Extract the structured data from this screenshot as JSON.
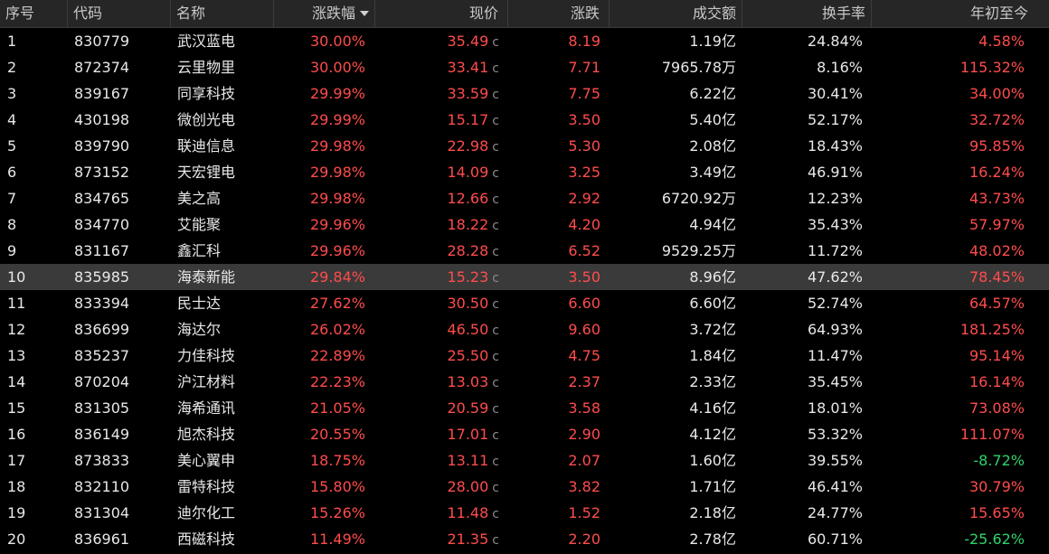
{
  "colors": {
    "up": "#ff4c4c",
    "down": "#2fd36a",
    "header_bg": "#262626",
    "row_selected_bg": "#3a3a3a",
    "background": "#000000"
  },
  "header": {
    "index": "序号",
    "code": "代码",
    "name": "名称",
    "change_pct": "涨跌幅",
    "price": "现价",
    "change": "涨跌",
    "turnover": "成交额",
    "turnover_rate": "换手率",
    "ytd": "年初至今"
  },
  "sort": {
    "column": "change_pct",
    "direction": "desc",
    "icon": "sort-desc-icon"
  },
  "selected_row": 10,
  "price_marker": "c",
  "rows": [
    {
      "index": "1",
      "code": "830779",
      "name": "武汉蓝电",
      "change_pct": "30.00%",
      "price": "35.49",
      "change": "8.19",
      "turnover": "1.19亿",
      "turnover_rate": "24.84%",
      "ytd": "4.58%",
      "ytd_dir": "up"
    },
    {
      "index": "2",
      "code": "872374",
      "name": "云里物里",
      "change_pct": "30.00%",
      "price": "33.41",
      "change": "7.71",
      "turnover": "7965.78万",
      "turnover_rate": "8.16%",
      "ytd": "115.32%",
      "ytd_dir": "up"
    },
    {
      "index": "3",
      "code": "839167",
      "name": "同享科技",
      "change_pct": "29.99%",
      "price": "33.59",
      "change": "7.75",
      "turnover": "6.22亿",
      "turnover_rate": "30.41%",
      "ytd": "34.00%",
      "ytd_dir": "up"
    },
    {
      "index": "4",
      "code": "430198",
      "name": "微创光电",
      "change_pct": "29.99%",
      "price": "15.17",
      "change": "3.50",
      "turnover": "5.40亿",
      "turnover_rate": "52.17%",
      "ytd": "32.72%",
      "ytd_dir": "up"
    },
    {
      "index": "5",
      "code": "839790",
      "name": "联迪信息",
      "change_pct": "29.98%",
      "price": "22.98",
      "change": "5.30",
      "turnover": "2.08亿",
      "turnover_rate": "18.43%",
      "ytd": "95.85%",
      "ytd_dir": "up"
    },
    {
      "index": "6",
      "code": "873152",
      "name": "天宏锂电",
      "change_pct": "29.98%",
      "price": "14.09",
      "change": "3.25",
      "turnover": "3.49亿",
      "turnover_rate": "46.91%",
      "ytd": "16.24%",
      "ytd_dir": "up"
    },
    {
      "index": "7",
      "code": "834765",
      "name": "美之高",
      "change_pct": "29.98%",
      "price": "12.66",
      "change": "2.92",
      "turnover": "6720.92万",
      "turnover_rate": "12.23%",
      "ytd": "43.73%",
      "ytd_dir": "up"
    },
    {
      "index": "8",
      "code": "834770",
      "name": "艾能聚",
      "change_pct": "29.96%",
      "price": "18.22",
      "change": "4.20",
      "turnover": "4.94亿",
      "turnover_rate": "35.43%",
      "ytd": "57.97%",
      "ytd_dir": "up"
    },
    {
      "index": "9",
      "code": "831167",
      "name": "鑫汇科",
      "change_pct": "29.96%",
      "price": "28.28",
      "change": "6.52",
      "turnover": "9529.25万",
      "turnover_rate": "11.72%",
      "ytd": "48.02%",
      "ytd_dir": "up"
    },
    {
      "index": "10",
      "code": "835985",
      "name": "海泰新能",
      "change_pct": "29.84%",
      "price": "15.23",
      "change": "3.50",
      "turnover": "8.96亿",
      "turnover_rate": "47.62%",
      "ytd": "78.45%",
      "ytd_dir": "up"
    },
    {
      "index": "11",
      "code": "833394",
      "name": "民士达",
      "change_pct": "27.62%",
      "price": "30.50",
      "change": "6.60",
      "turnover": "6.60亿",
      "turnover_rate": "52.74%",
      "ytd": "64.57%",
      "ytd_dir": "up"
    },
    {
      "index": "12",
      "code": "836699",
      "name": "海达尔",
      "change_pct": "26.02%",
      "price": "46.50",
      "change": "9.60",
      "turnover": "3.72亿",
      "turnover_rate": "64.93%",
      "ytd": "181.25%",
      "ytd_dir": "up"
    },
    {
      "index": "13",
      "code": "835237",
      "name": "力佳科技",
      "change_pct": "22.89%",
      "price": "25.50",
      "change": "4.75",
      "turnover": "1.84亿",
      "turnover_rate": "11.47%",
      "ytd": "95.14%",
      "ytd_dir": "up"
    },
    {
      "index": "14",
      "code": "870204",
      "name": "沪江材料",
      "change_pct": "22.23%",
      "price": "13.03",
      "change": "2.37",
      "turnover": "2.33亿",
      "turnover_rate": "35.45%",
      "ytd": "16.14%",
      "ytd_dir": "up"
    },
    {
      "index": "15",
      "code": "831305",
      "name": "海希通讯",
      "change_pct": "21.05%",
      "price": "20.59",
      "change": "3.58",
      "turnover": "4.16亿",
      "turnover_rate": "18.01%",
      "ytd": "73.08%",
      "ytd_dir": "up"
    },
    {
      "index": "16",
      "code": "836149",
      "name": "旭杰科技",
      "change_pct": "20.55%",
      "price": "17.01",
      "change": "2.90",
      "turnover": "4.12亿",
      "turnover_rate": "53.32%",
      "ytd": "111.07%",
      "ytd_dir": "up"
    },
    {
      "index": "17",
      "code": "873833",
      "name": "美心翼申",
      "change_pct": "18.75%",
      "price": "13.11",
      "change": "2.07",
      "turnover": "1.60亿",
      "turnover_rate": "39.55%",
      "ytd": "-8.72%",
      "ytd_dir": "down"
    },
    {
      "index": "18",
      "code": "832110",
      "name": "雷特科技",
      "change_pct": "15.80%",
      "price": "28.00",
      "change": "3.82",
      "turnover": "1.71亿",
      "turnover_rate": "46.41%",
      "ytd": "30.79%",
      "ytd_dir": "up"
    },
    {
      "index": "19",
      "code": "831304",
      "name": "迪尔化工",
      "change_pct": "15.26%",
      "price": "11.48",
      "change": "1.52",
      "turnover": "2.18亿",
      "turnover_rate": "24.77%",
      "ytd": "15.65%",
      "ytd_dir": "up"
    },
    {
      "index": "20",
      "code": "836961",
      "name": "西磁科技",
      "change_pct": "11.49%",
      "price": "21.35",
      "change": "2.20",
      "turnover": "2.78亿",
      "turnover_rate": "60.71%",
      "ytd": "-25.62%",
      "ytd_dir": "down"
    }
  ]
}
